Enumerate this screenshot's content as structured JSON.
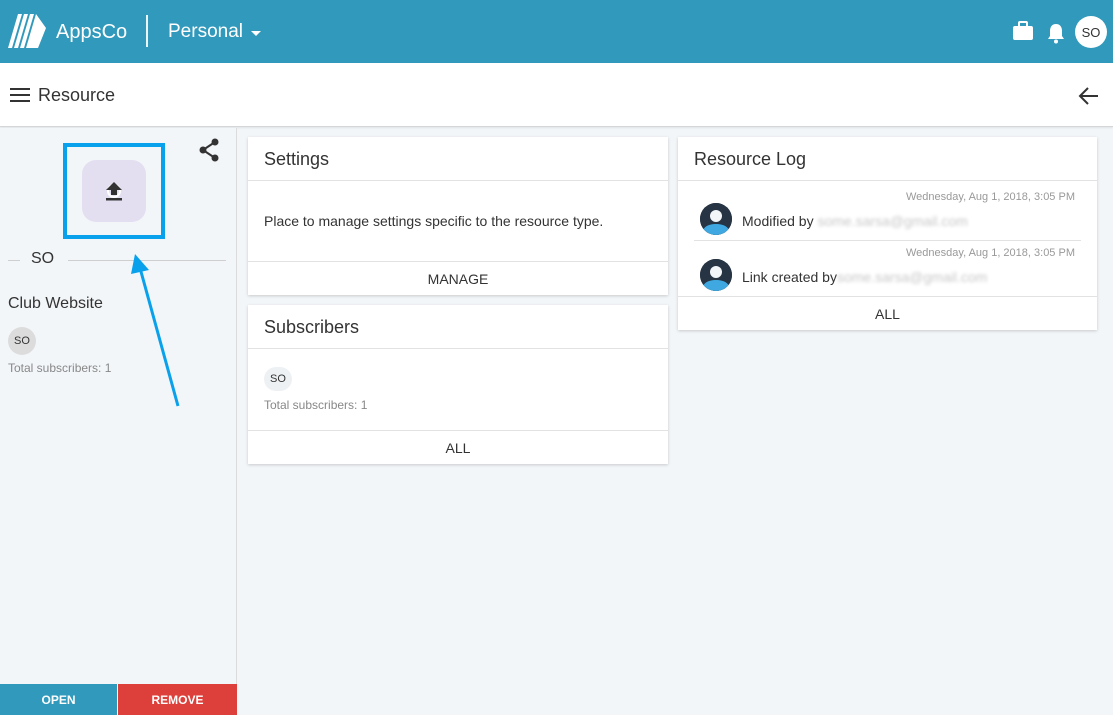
{
  "topbar": {
    "app_name": "AppsCo",
    "account_label": "Personal",
    "avatar_initials": "SO"
  },
  "subheader": {
    "title": "Resource"
  },
  "sidebar": {
    "owner_initials": "SO",
    "resource_name": "Club Website",
    "subscriber_initials": "SO",
    "total_subscribers": "Total subscribers: 1",
    "open_label": "OPEN",
    "remove_label": "REMOVE"
  },
  "settings_card": {
    "title": "Settings",
    "description": "Place to manage settings specific to the resource type.",
    "action_label": "MANAGE"
  },
  "subscribers_card": {
    "title": "Subscribers",
    "subscriber_initials": "SO",
    "total_subscribers": "Total subscribers: 1",
    "action_label": "ALL"
  },
  "resource_log": {
    "title": "Resource Log",
    "entries": [
      {
        "timestamp": "Wednesday, Aug 1, 2018, 3:05 PM",
        "text": "Modified by",
        "user": "some.sarsa@gmail.com"
      },
      {
        "timestamp": "Wednesday, Aug 1, 2018, 3:05 PM",
        "text": "Link created by",
        "user": "some.sarsa@gmail.com"
      }
    ],
    "action_label": "ALL"
  },
  "colors": {
    "brand": "#3199bb",
    "danger": "#dd3f3a",
    "highlight": "#0aa1ec"
  },
  "icons": [
    "logo-icon",
    "chevron-down-icon",
    "briefcase-icon",
    "bell-icon",
    "menu-icon",
    "back-arrow-icon",
    "share-icon",
    "upload-icon",
    "user-avatar-icon"
  ]
}
